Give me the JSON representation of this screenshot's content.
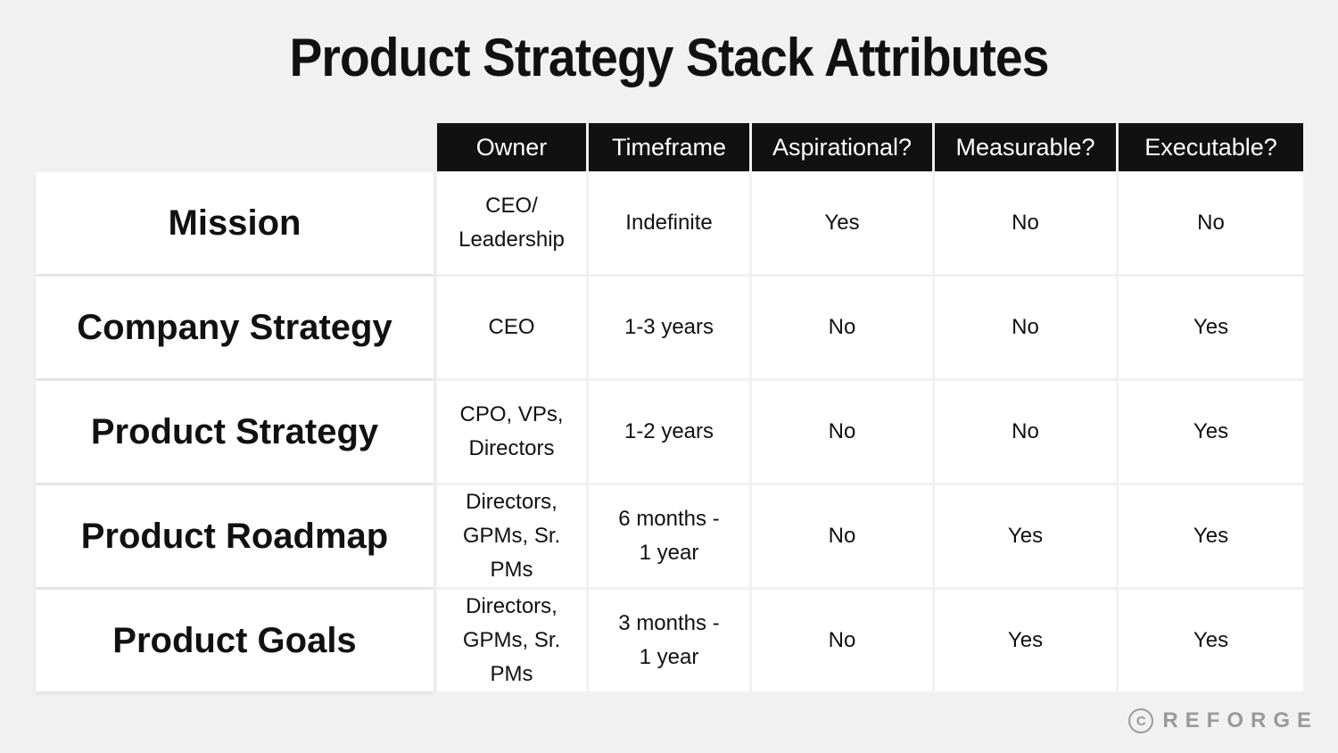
{
  "title": "Product Strategy Stack Attributes",
  "columns": [
    "Owner",
    "Timeframe",
    "Aspirational?",
    "Measurable?",
    "Executable?"
  ],
  "rows": [
    {
      "label": "Mission",
      "cells": [
        "CEO/\nLeadership",
        "Indefinite",
        "Yes",
        "No",
        "No"
      ]
    },
    {
      "label": "Company Strategy",
      "cells": [
        "CEO",
        "1-3 years",
        "No",
        "No",
        "Yes"
      ]
    },
    {
      "label": "Product Strategy",
      "cells": [
        "CPO, VPs,\nDirectors",
        "1-2 years",
        "No",
        "No",
        "Yes"
      ]
    },
    {
      "label": "Product Roadmap",
      "cells": [
        "Directors,\nGPMs, Sr.\nPMs",
        "6 months -\n1 year",
        "No",
        "Yes",
        "Yes"
      ]
    },
    {
      "label": "Product Goals",
      "cells": [
        "Directors,\nGPMs, Sr.\nPMs",
        "3 months -\n1 year",
        "No",
        "Yes",
        "Yes"
      ]
    }
  ],
  "logo": {
    "icon": "copyright-icon",
    "symbol": "C",
    "text": "REFORGE"
  }
}
